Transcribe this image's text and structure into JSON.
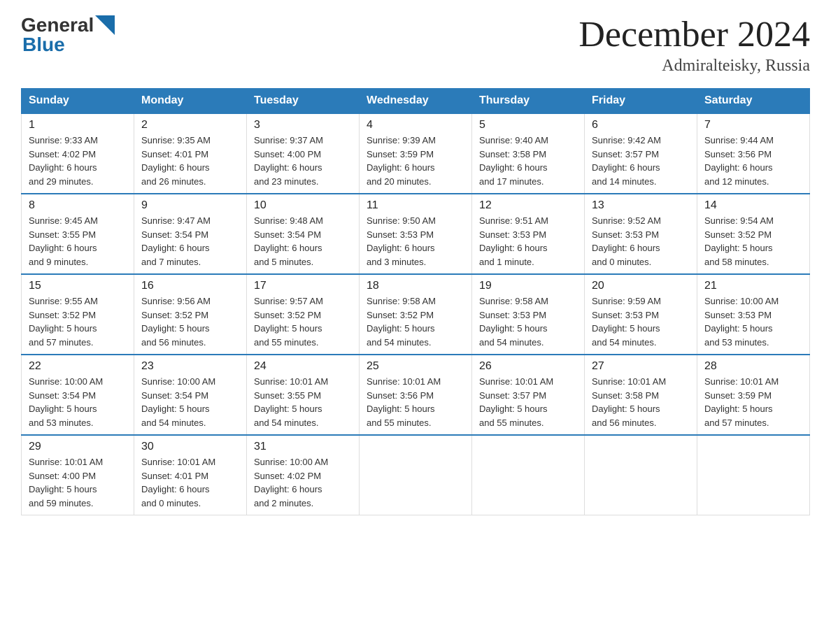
{
  "header": {
    "logo": {
      "general": "General",
      "blue": "Blue"
    },
    "month_title": "December 2024",
    "location": "Admiralteisky, Russia"
  },
  "weekdays": [
    "Sunday",
    "Monday",
    "Tuesday",
    "Wednesday",
    "Thursday",
    "Friday",
    "Saturday"
  ],
  "weeks": [
    [
      {
        "day": "1",
        "sunrise": "Sunrise: 9:33 AM",
        "sunset": "Sunset: 4:02 PM",
        "daylight": "Daylight: 6 hours",
        "daylight2": "and 29 minutes."
      },
      {
        "day": "2",
        "sunrise": "Sunrise: 9:35 AM",
        "sunset": "Sunset: 4:01 PM",
        "daylight": "Daylight: 6 hours",
        "daylight2": "and 26 minutes."
      },
      {
        "day": "3",
        "sunrise": "Sunrise: 9:37 AM",
        "sunset": "Sunset: 4:00 PM",
        "daylight": "Daylight: 6 hours",
        "daylight2": "and 23 minutes."
      },
      {
        "day": "4",
        "sunrise": "Sunrise: 9:39 AM",
        "sunset": "Sunset: 3:59 PM",
        "daylight": "Daylight: 6 hours",
        "daylight2": "and 20 minutes."
      },
      {
        "day": "5",
        "sunrise": "Sunrise: 9:40 AM",
        "sunset": "Sunset: 3:58 PM",
        "daylight": "Daylight: 6 hours",
        "daylight2": "and 17 minutes."
      },
      {
        "day": "6",
        "sunrise": "Sunrise: 9:42 AM",
        "sunset": "Sunset: 3:57 PM",
        "daylight": "Daylight: 6 hours",
        "daylight2": "and 14 minutes."
      },
      {
        "day": "7",
        "sunrise": "Sunrise: 9:44 AM",
        "sunset": "Sunset: 3:56 PM",
        "daylight": "Daylight: 6 hours",
        "daylight2": "and 12 minutes."
      }
    ],
    [
      {
        "day": "8",
        "sunrise": "Sunrise: 9:45 AM",
        "sunset": "Sunset: 3:55 PM",
        "daylight": "Daylight: 6 hours",
        "daylight2": "and 9 minutes."
      },
      {
        "day": "9",
        "sunrise": "Sunrise: 9:47 AM",
        "sunset": "Sunset: 3:54 PM",
        "daylight": "Daylight: 6 hours",
        "daylight2": "and 7 minutes."
      },
      {
        "day": "10",
        "sunrise": "Sunrise: 9:48 AM",
        "sunset": "Sunset: 3:54 PM",
        "daylight": "Daylight: 6 hours",
        "daylight2": "and 5 minutes."
      },
      {
        "day": "11",
        "sunrise": "Sunrise: 9:50 AM",
        "sunset": "Sunset: 3:53 PM",
        "daylight": "Daylight: 6 hours",
        "daylight2": "and 3 minutes."
      },
      {
        "day": "12",
        "sunrise": "Sunrise: 9:51 AM",
        "sunset": "Sunset: 3:53 PM",
        "daylight": "Daylight: 6 hours",
        "daylight2": "and 1 minute."
      },
      {
        "day": "13",
        "sunrise": "Sunrise: 9:52 AM",
        "sunset": "Sunset: 3:53 PM",
        "daylight": "Daylight: 6 hours",
        "daylight2": "and 0 minutes."
      },
      {
        "day": "14",
        "sunrise": "Sunrise: 9:54 AM",
        "sunset": "Sunset: 3:52 PM",
        "daylight": "Daylight: 5 hours",
        "daylight2": "and 58 minutes."
      }
    ],
    [
      {
        "day": "15",
        "sunrise": "Sunrise: 9:55 AM",
        "sunset": "Sunset: 3:52 PM",
        "daylight": "Daylight: 5 hours",
        "daylight2": "and 57 minutes."
      },
      {
        "day": "16",
        "sunrise": "Sunrise: 9:56 AM",
        "sunset": "Sunset: 3:52 PM",
        "daylight": "Daylight: 5 hours",
        "daylight2": "and 56 minutes."
      },
      {
        "day": "17",
        "sunrise": "Sunrise: 9:57 AM",
        "sunset": "Sunset: 3:52 PM",
        "daylight": "Daylight: 5 hours",
        "daylight2": "and 55 minutes."
      },
      {
        "day": "18",
        "sunrise": "Sunrise: 9:58 AM",
        "sunset": "Sunset: 3:52 PM",
        "daylight": "Daylight: 5 hours",
        "daylight2": "and 54 minutes."
      },
      {
        "day": "19",
        "sunrise": "Sunrise: 9:58 AM",
        "sunset": "Sunset: 3:53 PM",
        "daylight": "Daylight: 5 hours",
        "daylight2": "and 54 minutes."
      },
      {
        "day": "20",
        "sunrise": "Sunrise: 9:59 AM",
        "sunset": "Sunset: 3:53 PM",
        "daylight": "Daylight: 5 hours",
        "daylight2": "and 54 minutes."
      },
      {
        "day": "21",
        "sunrise": "Sunrise: 10:00 AM",
        "sunset": "Sunset: 3:53 PM",
        "daylight": "Daylight: 5 hours",
        "daylight2": "and 53 minutes."
      }
    ],
    [
      {
        "day": "22",
        "sunrise": "Sunrise: 10:00 AM",
        "sunset": "Sunset: 3:54 PM",
        "daylight": "Daylight: 5 hours",
        "daylight2": "and 53 minutes."
      },
      {
        "day": "23",
        "sunrise": "Sunrise: 10:00 AM",
        "sunset": "Sunset: 3:54 PM",
        "daylight": "Daylight: 5 hours",
        "daylight2": "and 54 minutes."
      },
      {
        "day": "24",
        "sunrise": "Sunrise: 10:01 AM",
        "sunset": "Sunset: 3:55 PM",
        "daylight": "Daylight: 5 hours",
        "daylight2": "and 54 minutes."
      },
      {
        "day": "25",
        "sunrise": "Sunrise: 10:01 AM",
        "sunset": "Sunset: 3:56 PM",
        "daylight": "Daylight: 5 hours",
        "daylight2": "and 55 minutes."
      },
      {
        "day": "26",
        "sunrise": "Sunrise: 10:01 AM",
        "sunset": "Sunset: 3:57 PM",
        "daylight": "Daylight: 5 hours",
        "daylight2": "and 55 minutes."
      },
      {
        "day": "27",
        "sunrise": "Sunrise: 10:01 AM",
        "sunset": "Sunset: 3:58 PM",
        "daylight": "Daylight: 5 hours",
        "daylight2": "and 56 minutes."
      },
      {
        "day": "28",
        "sunrise": "Sunrise: 10:01 AM",
        "sunset": "Sunset: 3:59 PM",
        "daylight": "Daylight: 5 hours",
        "daylight2": "and 57 minutes."
      }
    ],
    [
      {
        "day": "29",
        "sunrise": "Sunrise: 10:01 AM",
        "sunset": "Sunset: 4:00 PM",
        "daylight": "Daylight: 5 hours",
        "daylight2": "and 59 minutes."
      },
      {
        "day": "30",
        "sunrise": "Sunrise: 10:01 AM",
        "sunset": "Sunset: 4:01 PM",
        "daylight": "Daylight: 6 hours",
        "daylight2": "and 0 minutes."
      },
      {
        "day": "31",
        "sunrise": "Sunrise: 10:00 AM",
        "sunset": "Sunset: 4:02 PM",
        "daylight": "Daylight: 6 hours",
        "daylight2": "and 2 minutes."
      },
      null,
      null,
      null,
      null
    ]
  ]
}
